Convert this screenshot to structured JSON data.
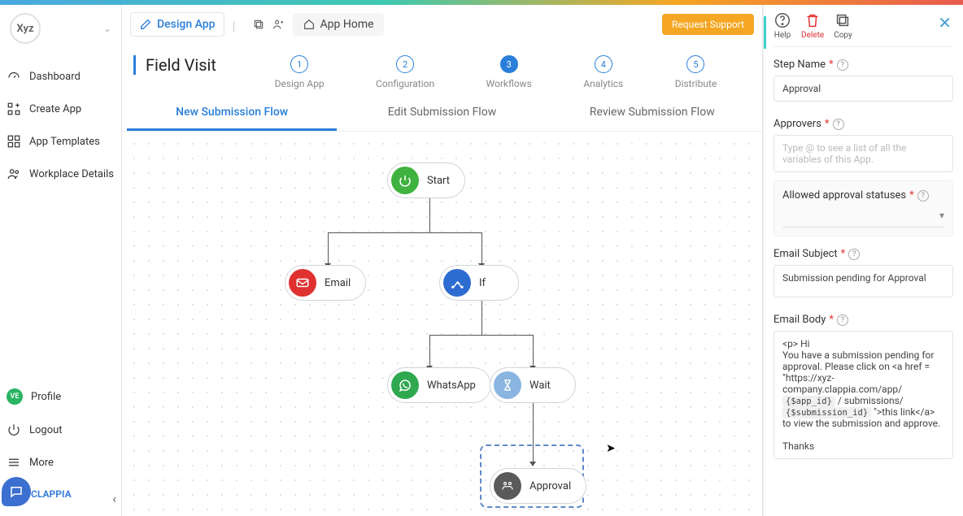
{
  "logo_text": "Xyz",
  "sidebar": {
    "items": [
      {
        "label": "Dashboard"
      },
      {
        "label": "Create App"
      },
      {
        "label": "App Templates"
      },
      {
        "label": "Workplace Details"
      }
    ],
    "profile_label": "Profile",
    "avatar_initials": "VE",
    "logout_label": "Logout",
    "more_label": "More",
    "brand_letter": "C",
    "brand_name": "CLAPPIA"
  },
  "header": {
    "design_app": "Design App",
    "app_home": "App Home",
    "request_support": "Request Support"
  },
  "page_title": "Field Visit",
  "steps": [
    {
      "num": "1",
      "label": "Design App",
      "active": false
    },
    {
      "num": "2",
      "label": "Configuration",
      "active": false
    },
    {
      "num": "3",
      "label": "Workflows",
      "active": true
    },
    {
      "num": "4",
      "label": "Analytics",
      "active": false
    },
    {
      "num": "5",
      "label": "Distribute",
      "active": false
    }
  ],
  "flow_tabs": [
    {
      "label": "New Submission Flow",
      "active": true
    },
    {
      "label": "Edit Submission Flow",
      "active": false
    },
    {
      "label": "Review Submission Flow",
      "active": false
    }
  ],
  "nodes": {
    "start": "Start",
    "email": "Email",
    "if": "If",
    "whatsapp": "WhatsApp",
    "wait": "Wait",
    "approval": "Approval"
  },
  "right_panel": {
    "help_label": "Help",
    "delete_label": "Delete",
    "copy_label": "Copy",
    "step_name_label": "Step Name",
    "step_name_value": "Approval",
    "approvers_label": "Approvers",
    "approvers_placeholder": "Type @ to see a list of all the variables of this App.",
    "allowed_statuses_label": "Allowed approval statuses",
    "email_subject_label": "Email Subject",
    "email_subject_value": "Submission pending for Approval",
    "email_body_label": "Email Body",
    "email_body_pre": "<p> Hi\nYou have a submission pending for approval. Please click on <a href = \"https://xyz-company.clappia.com/app/",
    "email_body_token1": "{$app_id}",
    "email_body_mid": " / submissions/ ",
    "email_body_token2": "{$submission_id}",
    "email_body_post": " \">this link</a> to view the submission and approve.",
    "email_body_thanks": "Thanks"
  }
}
